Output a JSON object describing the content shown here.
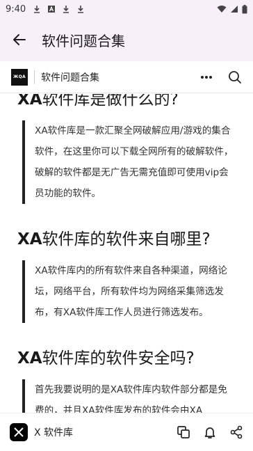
{
  "status_bar": {
    "time": "9:40"
  },
  "app_bar": {
    "title": "软件问题合集"
  },
  "site_header": {
    "logo_text": "ЖQA",
    "title": "软件问题合集"
  },
  "sections": [
    {
      "heading_prefix": "XA",
      "heading_rest": "软件库是做什么的?",
      "body": "XA软件库是一款汇聚全网破解应用/游戏的集合软件，在这里你可以下载全网所有的破解软件，破解的软件都是无广告无需充值即可使用vip会员功能的软件。"
    },
    {
      "heading_prefix": "XA",
      "heading_rest": "软件库的软件来自哪里?",
      "body": "XA软件库内的所有软件来自各种渠道，网络论坛，网络平台，所有软件均为网络采集筛选发布，有XA软件库工作人员进行筛选发布。"
    },
    {
      "heading_prefix": "XA",
      "heading_rest": "软件库的软件安全吗?",
      "body": "首先我要说明的是XA软件库内软件部分都是免费的，并且XA软件库发布的软件会由XA"
    }
  ],
  "bottom_bar": {
    "title": "X 软件库"
  },
  "colors": {
    "app_bar_bg": "#f7f0f8",
    "quote_border": "#222222"
  }
}
